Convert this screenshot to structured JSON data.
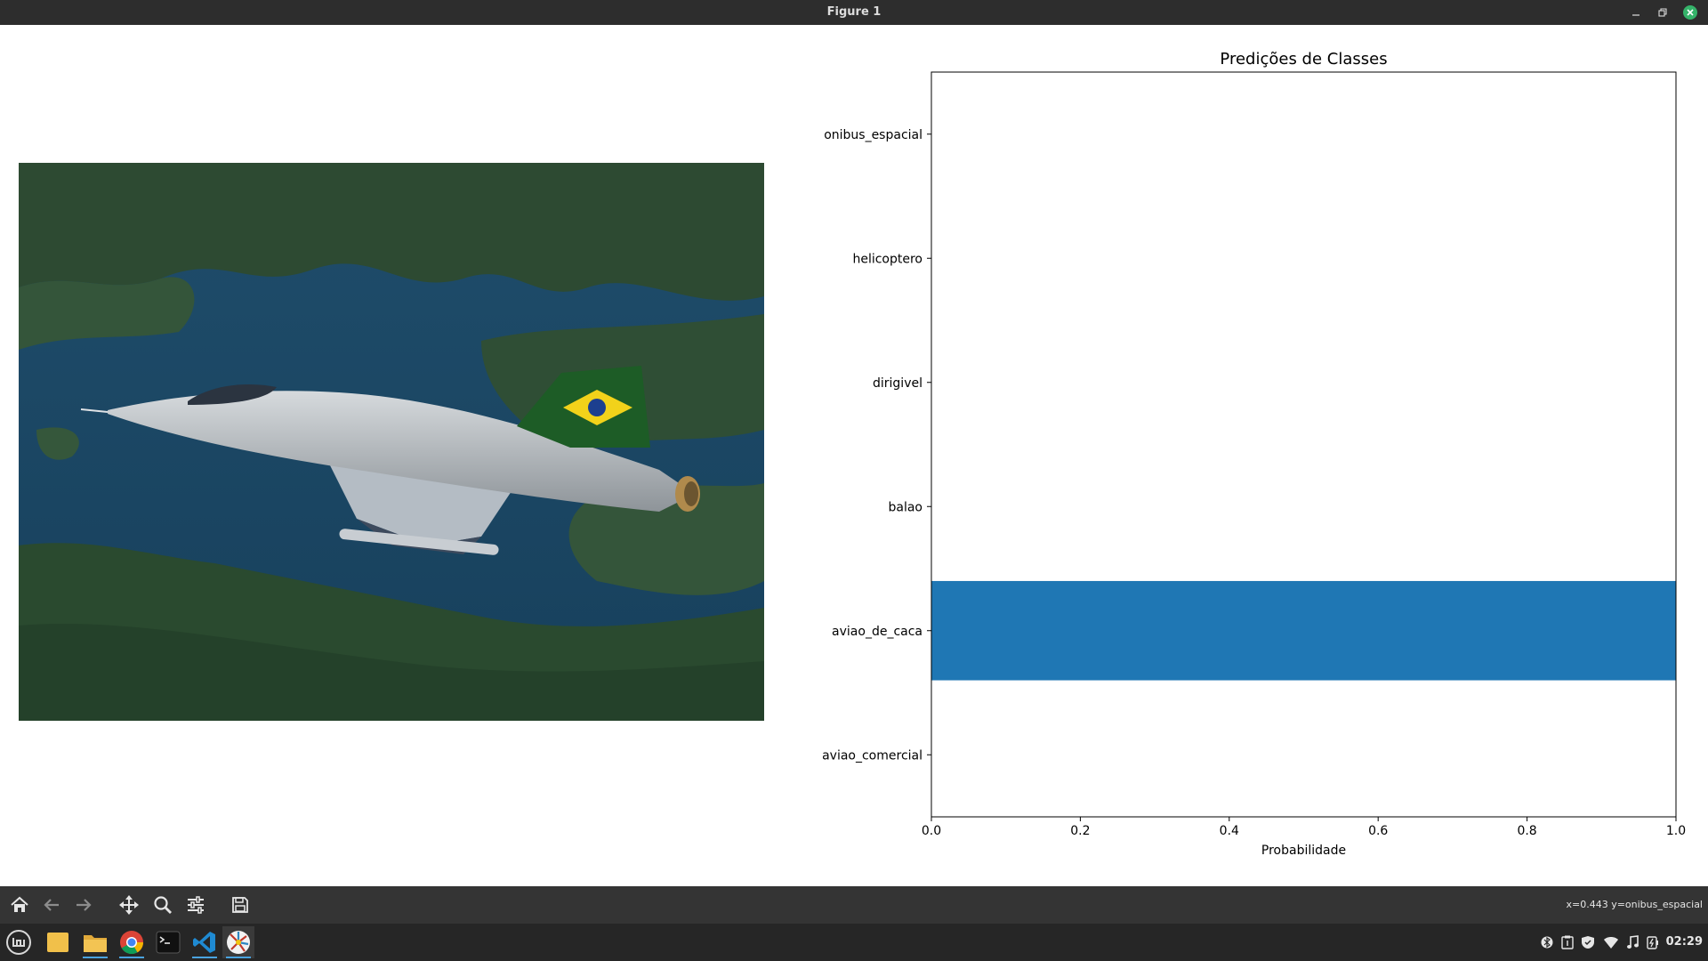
{
  "window": {
    "title": "Figure 1"
  },
  "chart_data": {
    "type": "bar",
    "orientation": "horizontal",
    "title": "Predições de Classes",
    "xlabel": "Probabilidade",
    "ylabel": "",
    "xlim": [
      0,
      1
    ],
    "xticks": [
      "0.0",
      "0.2",
      "0.4",
      "0.6",
      "0.8",
      "1.0"
    ],
    "categories": [
      "aviao_comercial",
      "aviao_de_caca",
      "balao",
      "dirigivel",
      "helicoptero",
      "onibus_espacial"
    ],
    "values": [
      0.0,
      1.0,
      0.0,
      0.0,
      0.0,
      0.0
    ],
    "bar_color": "#1f77b4",
    "grid": false,
    "legend": "none"
  },
  "toolbar": {
    "buttons": [
      {
        "id": "home",
        "icon": "home-icon"
      },
      {
        "id": "back",
        "icon": "arrow-left-icon"
      },
      {
        "id": "forward",
        "icon": "arrow-right-icon"
      },
      {
        "id": "pan",
        "icon": "move-icon"
      },
      {
        "id": "zoom",
        "icon": "magnifier-icon"
      },
      {
        "id": "configure",
        "icon": "sliders-icon"
      },
      {
        "id": "save",
        "icon": "floppy-icon"
      }
    ],
    "coords": "x=0.443 y=onibus_espacial"
  },
  "taskbar": {
    "apps": [
      "mint-menu-icon",
      "folder-icon",
      "files-icon",
      "chrome-icon",
      "terminal-icon",
      "vscode-icon",
      "python-icon"
    ],
    "clock": "02:29"
  },
  "colors": {
    "titlebar": "#2d2d2d",
    "toolbar": "#343434",
    "taskbar": "#262626",
    "close": "#35b36a",
    "bar": "#1f77b4"
  }
}
